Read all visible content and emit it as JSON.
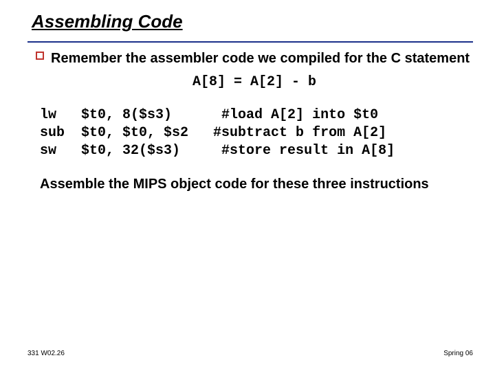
{
  "title": "Assembling Code",
  "bullet1": "Remember the assembler code we compiled  for the C statement",
  "expr": "A[8] = A[2] - b",
  "code": "lw   $t0, 8($s3)      #load A[2] into $t0\nsub  $t0, $t0, $s2   #subtract b from A[2]\nsw   $t0, 32($s3)     #store result in A[8]",
  "instruction": "Assemble the MIPS object code for these three instructions",
  "footer_left": "331 W02.26",
  "footer_right": "Spring 06"
}
